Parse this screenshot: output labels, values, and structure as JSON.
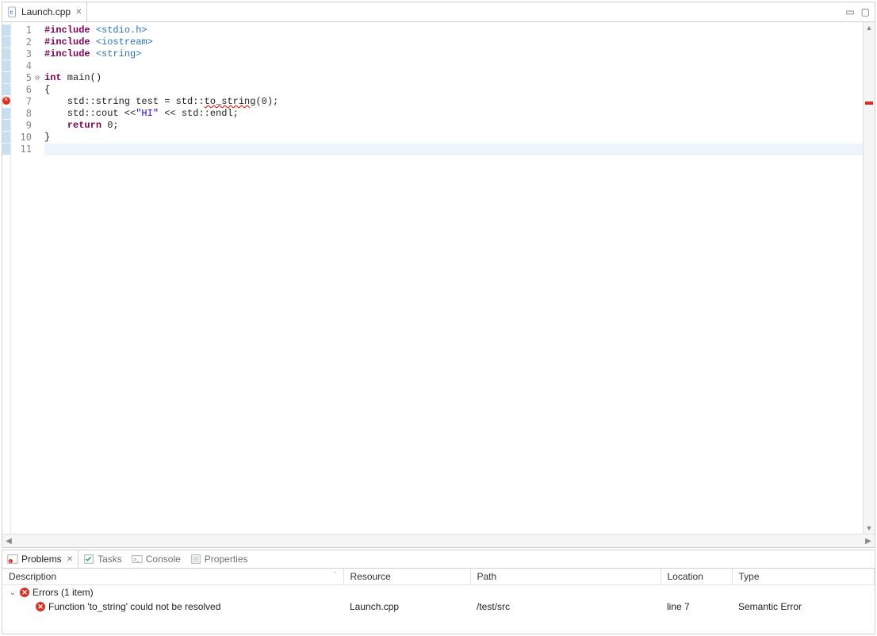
{
  "editor": {
    "file_name": "Launch.cpp",
    "lines": [
      {
        "n": 1,
        "segments": [
          {
            "t": "#include ",
            "c": "tk-include"
          },
          {
            "t": "<stdio.h>",
            "c": "tk-header"
          }
        ],
        "marker": "change"
      },
      {
        "n": 2,
        "segments": [
          {
            "t": "#include ",
            "c": "tk-include"
          },
          {
            "t": "<iostream>",
            "c": "tk-header"
          }
        ],
        "marker": "change"
      },
      {
        "n": 3,
        "segments": [
          {
            "t": "#include ",
            "c": "tk-include"
          },
          {
            "t": "<string>",
            "c": "tk-header"
          }
        ],
        "marker": "change"
      },
      {
        "n": 4,
        "segments": [
          {
            "t": "",
            "c": ""
          }
        ],
        "marker": "change"
      },
      {
        "n": 5,
        "segments": [
          {
            "t": "int",
            "c": "tk-keyword"
          },
          {
            "t": " main()",
            "c": ""
          }
        ],
        "marker": "change",
        "fold": "⊖"
      },
      {
        "n": 6,
        "segments": [
          {
            "t": "{",
            "c": ""
          }
        ],
        "marker": "change"
      },
      {
        "n": 7,
        "segments": [
          {
            "t": "    std::string test = std::",
            "c": ""
          },
          {
            "t": "to_string",
            "c": "tk-err"
          },
          {
            "t": "(0);",
            "c": ""
          }
        ],
        "marker": "error"
      },
      {
        "n": 8,
        "segments": [
          {
            "t": "    std::cout <<",
            "c": ""
          },
          {
            "t": "\"HI\"",
            "c": "tk-str"
          },
          {
            "t": " << std::endl;",
            "c": ""
          }
        ],
        "marker": "change"
      },
      {
        "n": 9,
        "segments": [
          {
            "t": "    ",
            "c": ""
          },
          {
            "t": "return",
            "c": "tk-keyword"
          },
          {
            "t": " 0;",
            "c": ""
          }
        ],
        "marker": "change"
      },
      {
        "n": 10,
        "segments": [
          {
            "t": "}",
            "c": ""
          }
        ],
        "marker": "change"
      },
      {
        "n": 11,
        "segments": [
          {
            "t": "",
            "c": ""
          }
        ],
        "marker": "change",
        "current": true
      }
    ]
  },
  "bottom": {
    "tabs": [
      {
        "id": "problems",
        "label": "Problems",
        "active": true
      },
      {
        "id": "tasks",
        "label": "Tasks",
        "active": false
      },
      {
        "id": "console",
        "label": "Console",
        "active": false
      },
      {
        "id": "properties",
        "label": "Properties",
        "active": false
      }
    ],
    "columns": {
      "description": "Description",
      "resource": "Resource",
      "path": "Path",
      "location": "Location",
      "type": "Type"
    },
    "group_label": "Errors (1 item)",
    "rows": [
      {
        "description": "Function 'to_string' could not be resolved",
        "resource": "Launch.cpp",
        "path": "/test/src",
        "location": "line 7",
        "type": "Semantic Error"
      }
    ]
  }
}
